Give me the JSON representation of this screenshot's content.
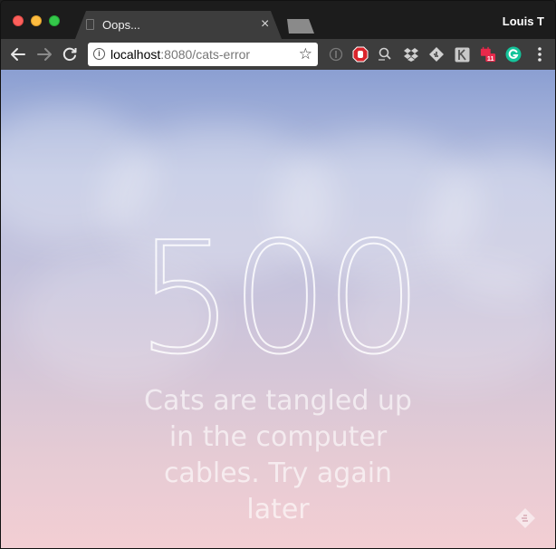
{
  "window": {
    "profile_name": "Louis T"
  },
  "tab": {
    "title": "Oops...",
    "close_glyph": "×"
  },
  "toolbar": {
    "url_host": "localhost",
    "url_path": ":8080/cats-error",
    "info_glyph": "i",
    "star_glyph": "☆",
    "extensions": [
      {
        "name": "disabled-extension-icon"
      },
      {
        "name": "adblock-icon"
      },
      {
        "name": "search-extension-icon"
      },
      {
        "name": "dropbox-icon"
      },
      {
        "name": "feedly-icon"
      },
      {
        "name": "k-extension-icon"
      },
      {
        "name": "calendar-extension-icon",
        "badge": "11"
      },
      {
        "name": "grammarly-icon"
      },
      {
        "name": "menu-icon"
      }
    ]
  },
  "page": {
    "error_code": "500",
    "error_message": "Cats are tangled up in the computer cables. Try again later"
  },
  "colors": {
    "sky_top": "#8b9fd2",
    "sky_bottom": "#f3ced3",
    "adblock_red": "#d9242b",
    "grammarly_green": "#15c39a",
    "calendar_badge": "#e8294b"
  }
}
